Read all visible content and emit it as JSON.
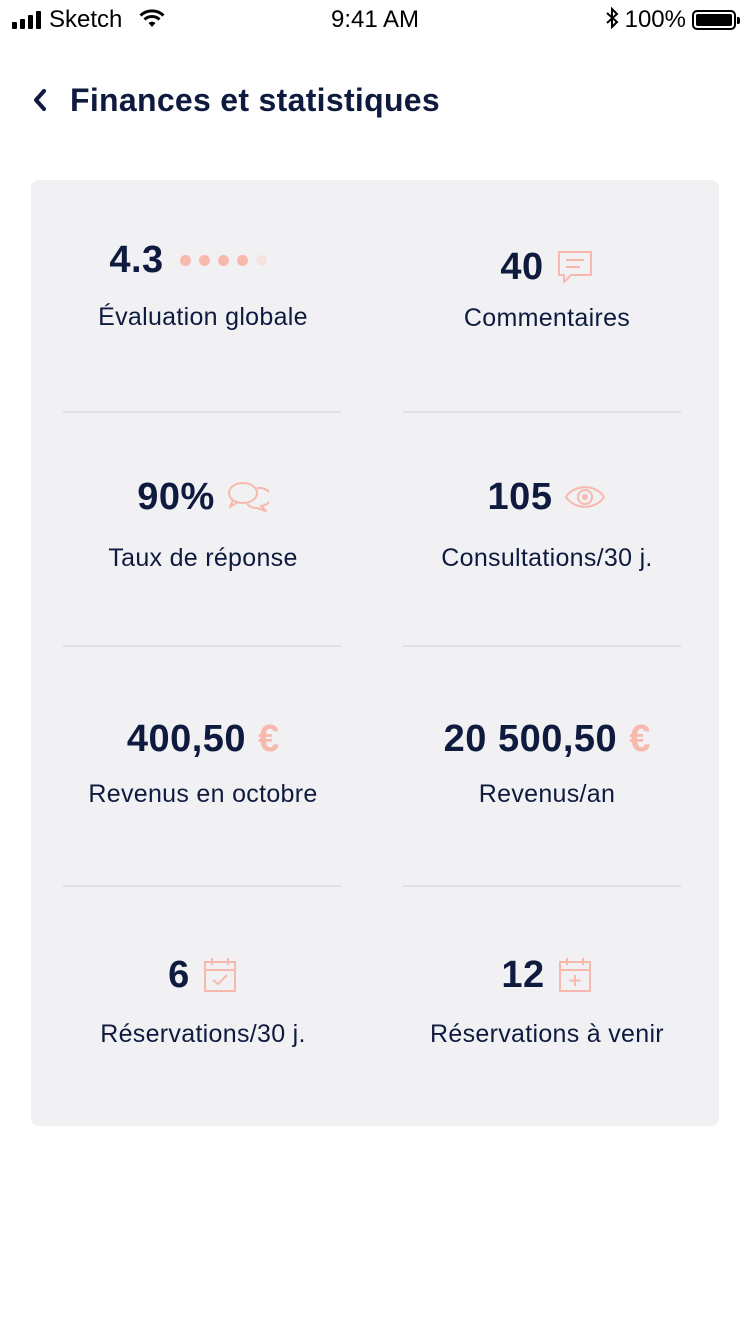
{
  "status_bar": {
    "carrier": "Sketch",
    "time": "9:41 AM",
    "battery": "100%"
  },
  "header": {
    "title": "Finances et statistiques"
  },
  "stats": {
    "rating": {
      "value": "4.3",
      "label": "Évaluation globale",
      "dots_filled": 4,
      "dots_total": 5
    },
    "comments": {
      "value": "40",
      "label": "Commentaires",
      "icon": "chat-bubble-icon"
    },
    "response": {
      "value": "90%",
      "label": "Taux de réponse",
      "icon": "conversation-icon"
    },
    "views": {
      "value": "105",
      "label": "Consultations/30 j.",
      "icon": "eye-icon"
    },
    "revenue_month": {
      "value": "400,50",
      "currency": "€",
      "label": "Revenus en octobre"
    },
    "revenue_year": {
      "value": "20 500,50",
      "currency": "€",
      "label": "Revenus/an"
    },
    "bookings_30": {
      "value": "6",
      "label": "Réservations/30 j.",
      "icon": "calendar-check-icon"
    },
    "bookings_upcoming": {
      "value": "12",
      "label": "Réservations à venir",
      "icon": "calendar-plus-icon"
    }
  },
  "colors": {
    "primary": "#0f1a3f",
    "accent": "#f7b9ad",
    "card_bg": "#f1f1f4"
  }
}
